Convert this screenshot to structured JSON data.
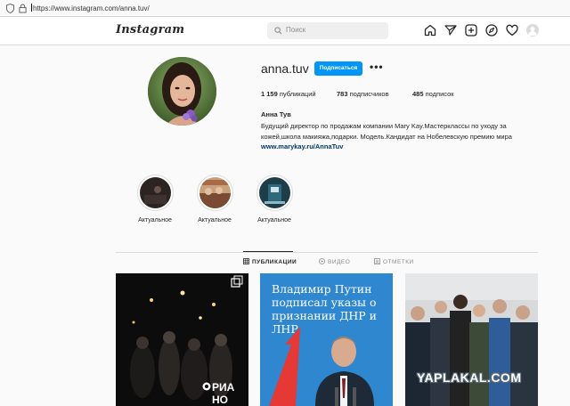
{
  "browser": {
    "url": "https://www.instagram.com/anna.tuv/"
  },
  "header": {
    "logo": "Instagram",
    "search_placeholder": "Поиск",
    "icons": [
      "home-icon",
      "direct-icon",
      "new-post-icon",
      "explore-icon",
      "activity-icon",
      "profile-avatar"
    ]
  },
  "profile": {
    "username": "anna.tuv",
    "follow_label": "Подписаться",
    "more_label": "•••",
    "stats": {
      "posts_count": "1 159",
      "posts_label": "публикаций",
      "followers_count": "783",
      "followers_label": "подписчиков",
      "following_count": "485",
      "following_label": "подписок"
    },
    "full_name": "Анна Тув",
    "bio_line1": "Будущий директор по продажам компании Mary Kay.Мастерклассы по уходу за",
    "bio_line2": "кожей,школа макияжа,подарки. Модель.Кандидат на Нобелевскую премию мира",
    "website": "www.marykay.ru/AnnaTuv"
  },
  "highlights": [
    {
      "label": "Актуальное"
    },
    {
      "label": "Актуальное"
    },
    {
      "label": "Актуальное"
    }
  ],
  "tabs": [
    {
      "label": "ПУБЛИКАЦИИ",
      "active": true
    },
    {
      "label": "ВИДЕО",
      "active": false
    },
    {
      "label": "ОТМЕТКИ",
      "active": false
    }
  ],
  "posts": [
    {
      "overlay_text": "РИА НО"
    },
    {
      "headline": "Владимир Путин подписал указы о признании ДНР и ЛНР"
    },
    {}
  ],
  "watermark": "YAPLAKAL.COM",
  "colors": {
    "accent": "#0095f6",
    "link": "#00376b"
  }
}
